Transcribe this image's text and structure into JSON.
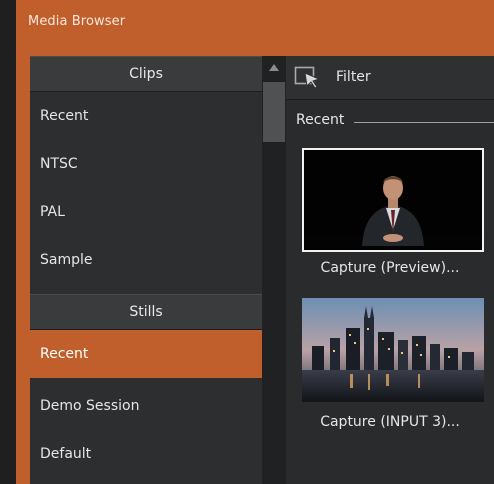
{
  "window": {
    "title": "Media Browser"
  },
  "sidebar": {
    "sections": [
      {
        "label": "Clips",
        "items": [
          {
            "label": "Recent"
          },
          {
            "label": "NTSC"
          },
          {
            "label": "PAL"
          },
          {
            "label": "Sample"
          }
        ]
      },
      {
        "label": "Stills",
        "items": [
          {
            "label": "Recent",
            "selected": true
          },
          {
            "label": "Demo Session"
          },
          {
            "label": "Default"
          }
        ]
      }
    ]
  },
  "pane": {
    "filter_label": "Filter",
    "group_label": "Recent",
    "thumbnails": [
      {
        "caption": "Capture (Preview)...",
        "selected": true
      },
      {
        "caption": "Capture (INPUT 3)..."
      }
    ]
  },
  "colors": {
    "accent": "#c15f2c",
    "panel": "#2d2e30",
    "header": "#3a3b3d"
  }
}
